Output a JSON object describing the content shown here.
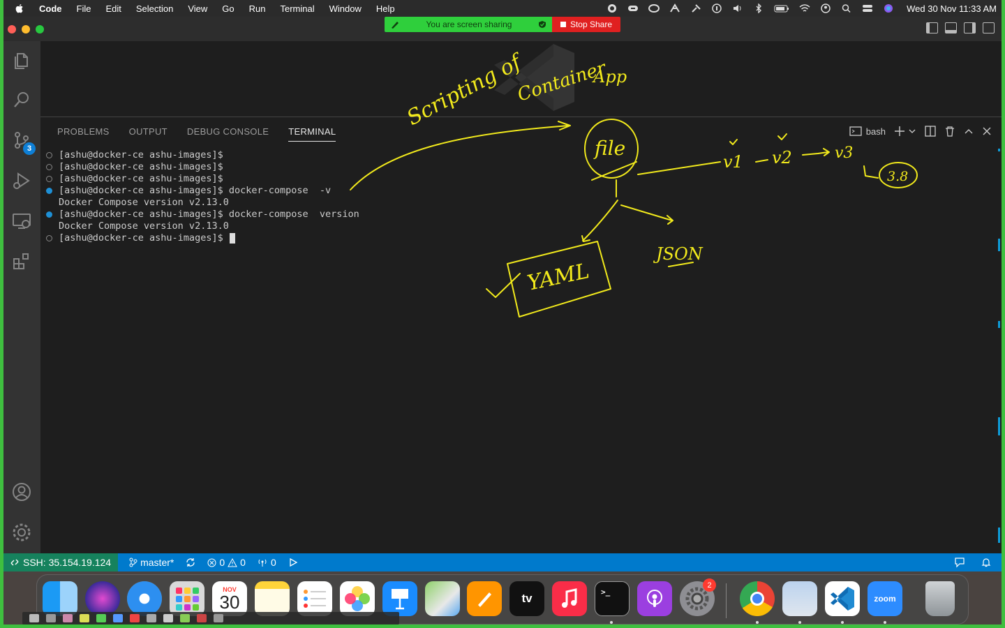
{
  "menubar": {
    "app_name": "Code",
    "items": [
      "File",
      "Edit",
      "Selection",
      "View",
      "Go",
      "Run",
      "Terminal",
      "Window",
      "Help"
    ],
    "clock": "Wed 30 Nov  11:33 AM"
  },
  "share_banner": {
    "message": "You are screen sharing",
    "stop_label": "Stop Share"
  },
  "activity_bar": {
    "scm_badge": "3"
  },
  "panel": {
    "tabs": [
      "PROBLEMS",
      "OUTPUT",
      "DEBUG CONSOLE",
      "TERMINAL"
    ],
    "active_tab": "TERMINAL",
    "shell_label": "bash"
  },
  "terminal": {
    "lines": [
      {
        "marker": "hollow",
        "text": "[ashu@docker-ce ashu-images]$"
      },
      {
        "marker": "hollow",
        "text": "[ashu@docker-ce ashu-images]$"
      },
      {
        "marker": "hollow",
        "text": "[ashu@docker-ce ashu-images]$"
      },
      {
        "marker": "blue",
        "text": "[ashu@docker-ce ashu-images]$ docker-compose  -v"
      },
      {
        "marker": "none",
        "text": "Docker Compose version v2.13.0"
      },
      {
        "marker": "blue",
        "text": "[ashu@docker-ce ashu-images]$ docker-compose  version"
      },
      {
        "marker": "none",
        "text": "Docker Compose version v2.13.0"
      },
      {
        "marker": "hollow",
        "text": "[ashu@docker-ce ashu-images]$ "
      }
    ]
  },
  "statusbar": {
    "ssh": "SSH: 35.154.19.124",
    "branch": "master*",
    "errors": "0",
    "warnings": "0",
    "ports": "0"
  },
  "dock": {
    "calendar_month": "NOV",
    "calendar_day": "30",
    "settings_badge": "2",
    "zoom_label": "zoom"
  },
  "handwriting": {
    "scripting": "Scripting of",
    "container": "Container",
    "app": "App",
    "file": "file",
    "v1": "v1",
    "v2": "v2",
    "v3": "v3",
    "v38": "3.8",
    "json": "JSON",
    "yaml": "YAML"
  },
  "colors": {
    "status_bar": "#007acc",
    "ssh_remote": "#16825d",
    "ink": "#f2ea1c",
    "share_green": "#2fcf3c",
    "stop_red": "#e02020"
  }
}
